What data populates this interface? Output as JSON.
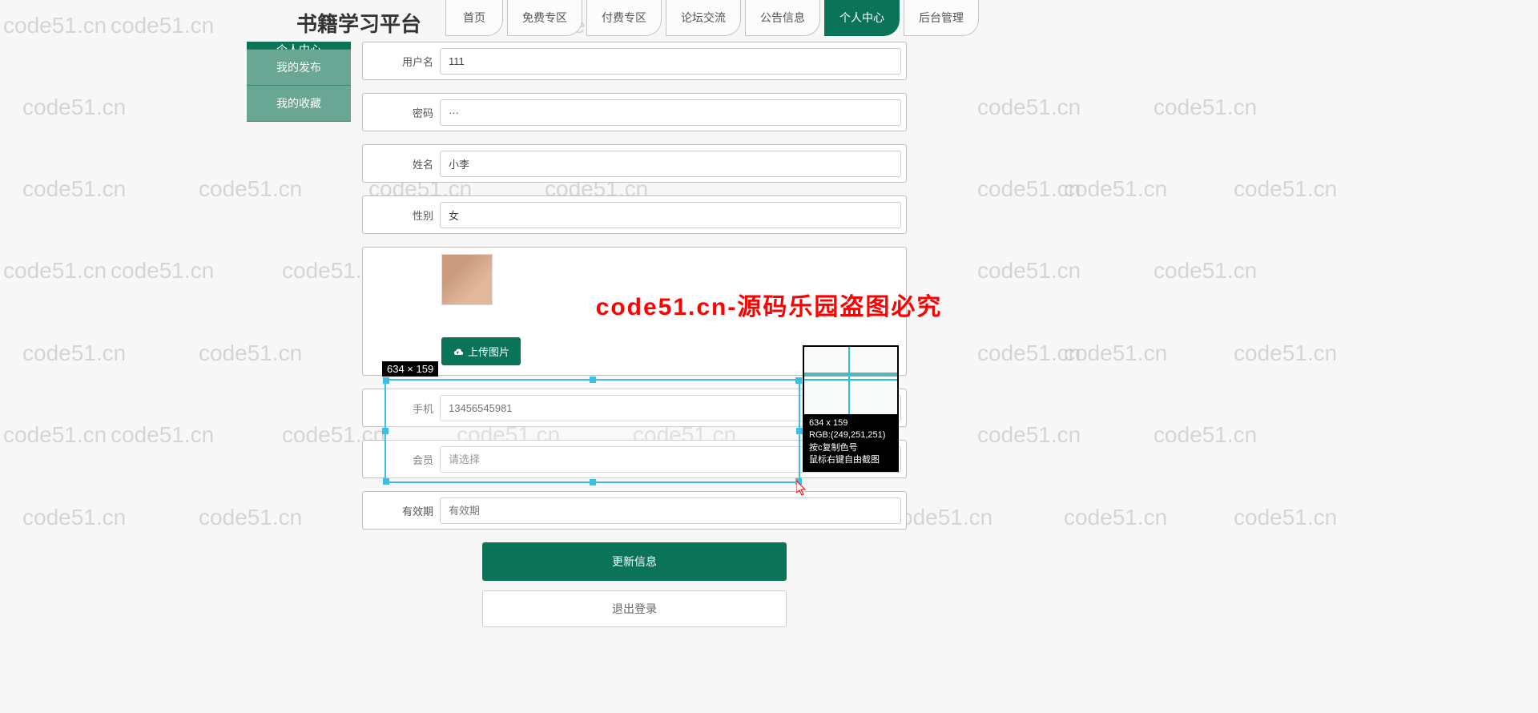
{
  "watermark_text": "code51.cn",
  "header": {
    "logo": "书籍学习平台",
    "nav": [
      "首页",
      "免费专区",
      "付费专区",
      "论坛交流",
      "公告信息",
      "个人中心",
      "后台管理"
    ],
    "active_index": 5
  },
  "sidebar": {
    "items": [
      {
        "label": "个人中心",
        "dim": false
      },
      {
        "label": "我的发布",
        "dim": true
      },
      {
        "label": "我的收藏",
        "dim": true
      }
    ]
  },
  "form": {
    "username_label": "用户名",
    "username_value": "111",
    "password_label": "密码",
    "password_value": "···",
    "name_label": "姓名",
    "name_value": "小李",
    "gender_label": "性别",
    "gender_value": "女",
    "upload_label": "上传图片",
    "phone_label": "手机",
    "phone_value": "13456545981",
    "member_label": "会员",
    "member_placeholder": "请选择",
    "expire_label": "有效期",
    "expire_placeholder": "有效期",
    "update_btn": "更新信息",
    "logout_btn": "退出登录"
  },
  "overlay_text": "code51.cn-源码乐园盗图必究",
  "screenshot_tool": {
    "dimensions": "634 × 159",
    "mag_dim": "634 x 159",
    "mag_rgb": "RGB:(249,251,251)",
    "mag_hint1": "按c复制色号",
    "mag_hint2": "鼠标右键自由截图"
  }
}
